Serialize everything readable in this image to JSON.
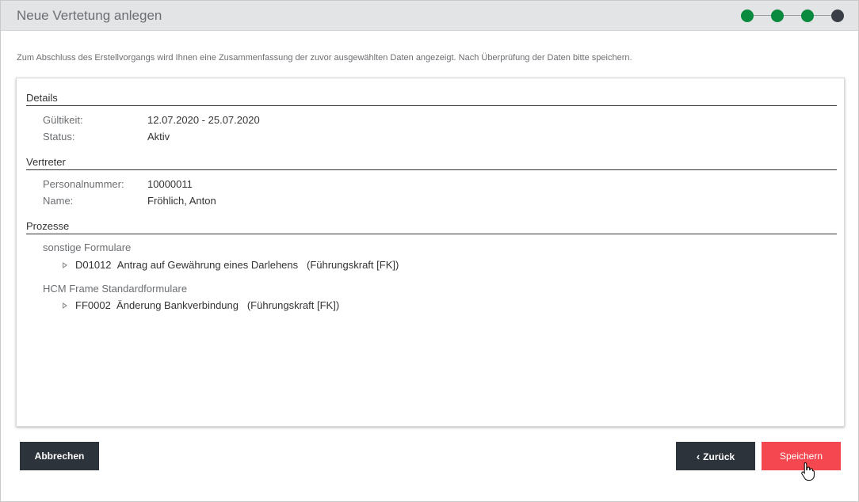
{
  "dialog": {
    "title": "Neue Vertetung anlegen",
    "intro": "Zum Abschluss des Erstellvorgangs wird Ihnen eine Zusammenfassung der zuvor ausgewählten Daten angezeigt. Nach Überprüfung der Daten bitte speichern."
  },
  "stepper": {
    "total_steps": 4,
    "current_step": 4,
    "completed_color": "#0a8a3e",
    "current_color": "#3a3f47"
  },
  "details": {
    "heading": "Details",
    "validity_label": "Gültikeit:",
    "validity_value": "12.07.2020 - 25.07.2020",
    "status_label": "Status:",
    "status_value": "Aktiv"
  },
  "substitute": {
    "heading": "Vertreter",
    "personnel_number_label": "Personalnummer:",
    "personnel_number_value": "10000011",
    "name_label": "Name:",
    "name_value": "Fröhlich, Anton"
  },
  "processes": {
    "heading": "Prozesse",
    "groups": [
      {
        "name": "sonstige Formulare",
        "items": [
          {
            "code": "D01012",
            "title": "Antrag auf Gewährung eines Darlehens",
            "role": "(Führungskraft [FK])"
          }
        ]
      },
      {
        "name": "HCM Frame Standardformulare",
        "items": [
          {
            "code": "FF0002",
            "title": "Änderung Bankverbindung",
            "role": "(Führungskraft [FK])"
          }
        ]
      }
    ]
  },
  "buttons": {
    "cancel": "Abbrechen",
    "back": "Zurück",
    "save": "Speichern"
  },
  "colors": {
    "accent_red": "#f4474f",
    "dark_button": "#2d333b"
  }
}
